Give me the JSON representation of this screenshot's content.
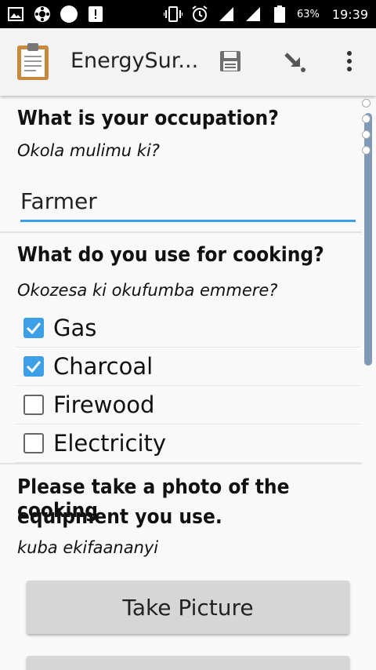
{
  "status_bar": {
    "battery": "63%",
    "time": "19:39"
  },
  "app_bar": {
    "title": "EnergySur..."
  },
  "questions": [
    {
      "title": "What is your occupation?",
      "hint": "Okola mulimu ki?",
      "value": "Farmer"
    },
    {
      "title": "What do you use for cooking?",
      "hint": "Okozesa ki okufumba emmere?",
      "options": [
        {
          "label": "Gas",
          "checked": true
        },
        {
          "label": "Charcoal",
          "checked": true
        },
        {
          "label": "Firewood",
          "checked": false
        },
        {
          "label": "Electricity",
          "checked": false
        }
      ]
    },
    {
      "title_line1": "Please take a photo of the cooking",
      "title_line2": "equipment you use.",
      "hint": "kuba ekifaananyi",
      "button_label": "Take Picture"
    }
  ],
  "colors": {
    "accent": "#3d9fe6",
    "app_bar_bg": "#f3f3f3",
    "button_bg": "#d6d6d6"
  },
  "icons": [
    "image-icon",
    "settings-icon",
    "circle-icon",
    "alert-icon",
    "vibrate-icon",
    "alarm-icon",
    "signal-icon",
    "battery-icon",
    "clipboard-icon",
    "save-icon",
    "forward-icon",
    "more-vert-icon"
  ]
}
